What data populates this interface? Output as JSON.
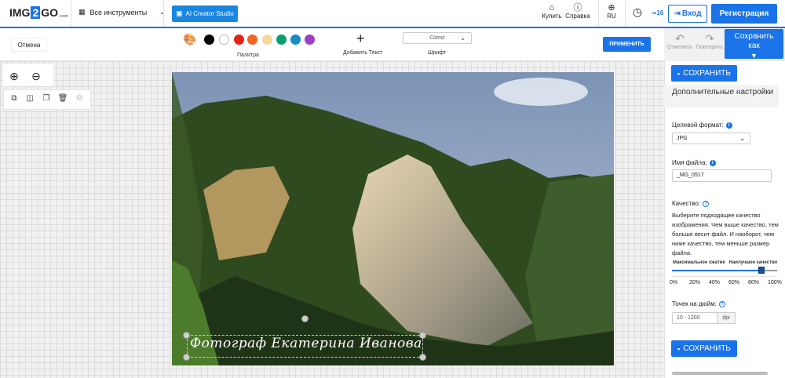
{
  "header": {
    "logo_left": "IMG",
    "logo_mid": "2",
    "logo_right": "GO",
    "logo_suffix": ".com",
    "tools_label": "Все инструменты",
    "ai_label": "AI Creator Studio",
    "buy_label": "Купить",
    "help_label": "Справка",
    "lang_label": "RU",
    "history_count": "16",
    "login_label": "Вход",
    "register_label": "Регистрация"
  },
  "toolbar": {
    "cancel_label": "Отмена",
    "palette_label": "Палитра",
    "add_text_label": "Добавить Текст",
    "font_label": "Шрифт",
    "font_value": "Comic",
    "apply_label": "ПРИМЕНИТЬ",
    "colors": [
      "#000000",
      "#ffffff",
      "#e2231a",
      "#f26522",
      "#f7d79a",
      "#0aa06e",
      "#1a8cc4",
      "#9b40c4"
    ]
  },
  "canvas": {
    "caption": "Фотограф Екатерина Иванова"
  },
  "panel": {
    "undo_label": "Отменить",
    "redo_label": "Повторить",
    "save_as_label": "Сохранить как",
    "save_label": "СОХРАНИТЬ",
    "section_title": "Дополнительные настройки",
    "format_label": "Целевой формат:",
    "format_value": "JPG",
    "filename_label": "Имя файла:",
    "filename_value": "_MG_0517",
    "quality_label": "Качество:",
    "quality_desc": "Выберите подходящее качество изображения. Чем выше качество, тем больше весит файл. И наоборот, чем ниже качество, тем меньше размер файла.",
    "slider_left": "Максимальное сжатие",
    "slider_right": "Наилучшее качество",
    "quality_value": 0.85,
    "ticks": [
      "0%",
      "20%",
      "40%",
      "60%",
      "80%",
      "100%"
    ],
    "dpi_label": "Точек на дюйм:",
    "dpi_placeholder": "10 - 1200",
    "dpi_unit": "dpi"
  }
}
